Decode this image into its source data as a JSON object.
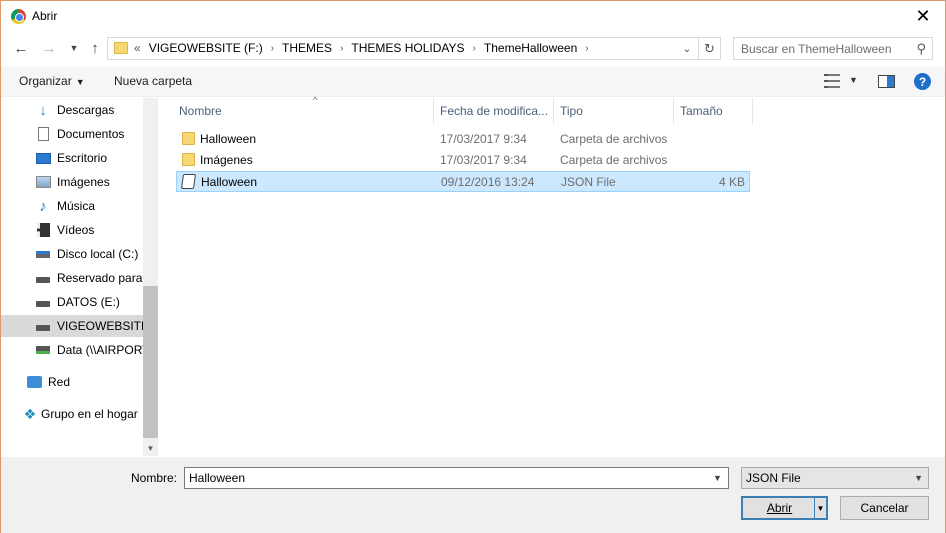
{
  "window": {
    "title": "Abrir",
    "close_glyph": "✕"
  },
  "nav": {
    "back_icon": "arrow-left-icon",
    "forward_icon": "arrow-right-icon",
    "recent_icon": "chevron-down-icon",
    "up_icon": "arrow-up-icon"
  },
  "address": {
    "overflow": "«",
    "crumbs": [
      "VIGEOWEBSITE (F:)",
      "THEMES",
      "THEMES HOLIDAYS",
      "ThemeHalloween"
    ],
    "separator": "›"
  },
  "search": {
    "placeholder": "Buscar en ThemeHalloween"
  },
  "toolbar": {
    "organize_label": "Organizar",
    "new_folder_label": "Nueva carpeta",
    "help_label": "?"
  },
  "sidebar": {
    "items": [
      {
        "label": "Descargas",
        "icon": "download-icon"
      },
      {
        "label": "Documentos",
        "icon": "document-icon"
      },
      {
        "label": "Escritorio",
        "icon": "desktop-icon"
      },
      {
        "label": "Imágenes",
        "icon": "pictures-icon"
      },
      {
        "label": "Música",
        "icon": "music-icon"
      },
      {
        "label": "Vídeos",
        "icon": "video-icon"
      },
      {
        "label": "Disco local (C:)",
        "icon": "drive-windows-icon"
      },
      {
        "label": "Reservado para el sistema",
        "icon": "drive-icon"
      },
      {
        "label": "DATOS (E:)",
        "icon": "drive-icon"
      },
      {
        "label": "VIGEOWEBSITE (F:)",
        "icon": "drive-icon",
        "selected": true
      },
      {
        "label": "Data (\\\\AIRPORT",
        "icon": "network-drive-icon"
      },
      {
        "label": "Red",
        "icon": "network-icon"
      },
      {
        "label": "Grupo en el hogar",
        "icon": "homegroup-icon"
      }
    ]
  },
  "filelist": {
    "columns": [
      "Nombre",
      "Fecha de modifica...",
      "Tipo",
      "Tamaño"
    ],
    "rows": [
      {
        "name": "Halloween",
        "date": "17/03/2017 9:34",
        "type": "Carpeta de archivos",
        "size": "",
        "icon": "folder-icon"
      },
      {
        "name": "Imágenes",
        "date": "17/03/2017 9:34",
        "type": "Carpeta de archivos",
        "size": "",
        "icon": "folder-icon"
      },
      {
        "name": "Halloween",
        "date": "09/12/2016 13:24",
        "type": "JSON File",
        "size": "4 KB",
        "icon": "json-file-icon",
        "selected": true
      }
    ]
  },
  "bottom": {
    "name_label": "Nombre:",
    "name_value": "Halloween",
    "file_type": "JSON File",
    "open_label": "Abrir",
    "cancel_label": "Cancelar"
  },
  "colors": {
    "accent": "#2b79d0",
    "selection": "#cce8ff",
    "window_border": "#d99a6c"
  }
}
